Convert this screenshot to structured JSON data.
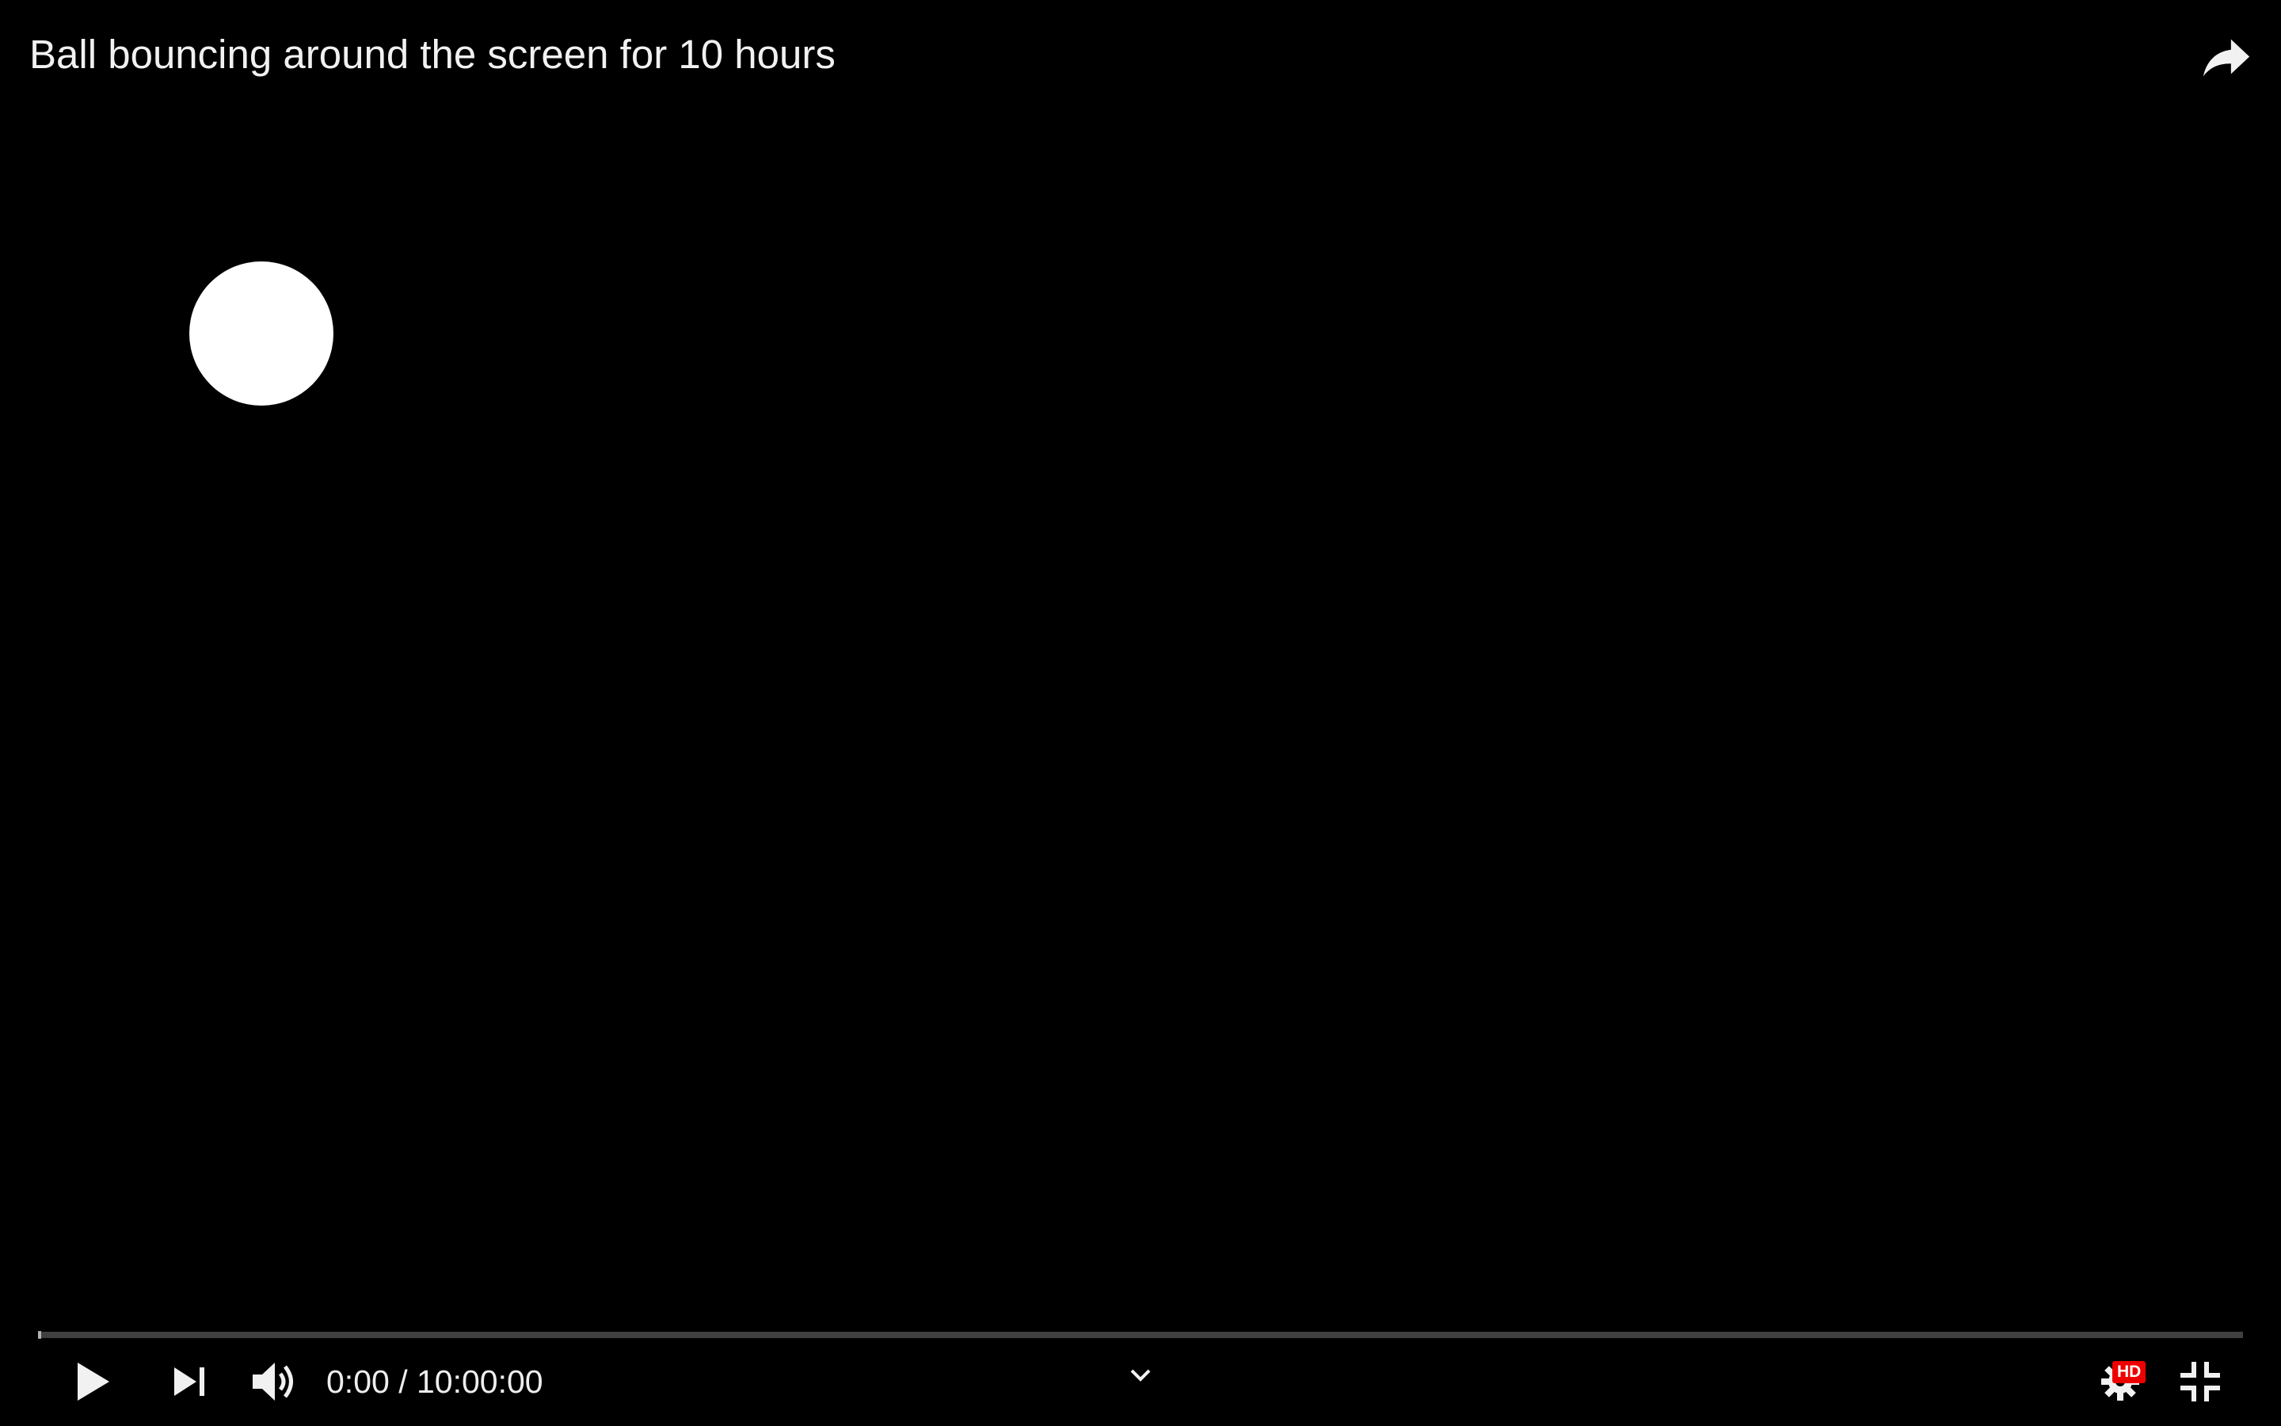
{
  "video": {
    "title": "Ball bouncing around the screen for 10 hours"
  },
  "player": {
    "current_time": "0:00",
    "duration": "10:00:00",
    "time_display": "0:00 / 10:00:00",
    "progress": 0,
    "quality_badge": "HD"
  },
  "icons": {
    "share": "share-arrow-icon",
    "play": "play-icon",
    "next": "skip-next-icon",
    "volume": "volume-high-icon",
    "chevron": "chevron-down-icon",
    "settings": "gear-icon",
    "exit_fullscreen": "exit-fullscreen-icon"
  },
  "colors": {
    "background": "#000000",
    "text": "#eeeeee",
    "badge": "#e00000",
    "ball": "#ffffff"
  }
}
